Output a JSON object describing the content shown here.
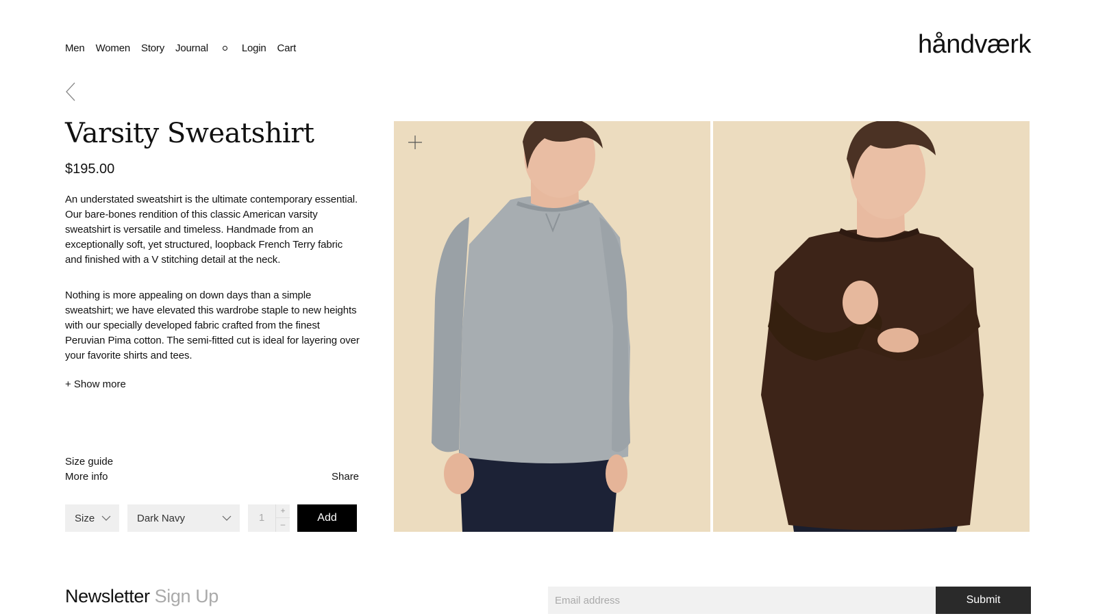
{
  "nav": {
    "links": [
      "Men",
      "Women",
      "Story",
      "Journal"
    ],
    "login": "Login",
    "cart": "Cart"
  },
  "brand": {
    "logo": "håndværk"
  },
  "product": {
    "title": "Varsity Sweatshirt",
    "price": "$195.00",
    "description_1": "An understated sweatshirt is the ultimate contemporary essential. Our bare-bones rendition of this classic American varsity sweatshirt is versatile and timeless. Handmade from an exceptionally soft, yet structured, loopback French Terry fabric and finished with a V stitching detail at the neck.",
    "description_2": "Nothing is more appealing on down days than a simple sweatshirt; we have elevated this wardrobe staple to new heights with our specially developed fabric crafted from the finest Peruvian Pima cotton. The semi-fitted cut is ideal for layering over your favorite shirts and tees.",
    "show_more": "+ Show more",
    "size_guide": "Size guide",
    "more_info": "More info",
    "share": "Share"
  },
  "purchase": {
    "size_label": "Size",
    "color_value": "Dark Navy",
    "quantity": "1",
    "qty_plus": "+",
    "qty_minus": "–",
    "add_label": "Add"
  },
  "gallery": {
    "background_color": "#ecdcbf",
    "icons": [
      "zoom-plus-icon"
    ]
  },
  "newsletter": {
    "title_part1": "Newsletter",
    "title_part2": "Sign Up",
    "email_placeholder": "Email address",
    "submit_label": "Submit"
  }
}
